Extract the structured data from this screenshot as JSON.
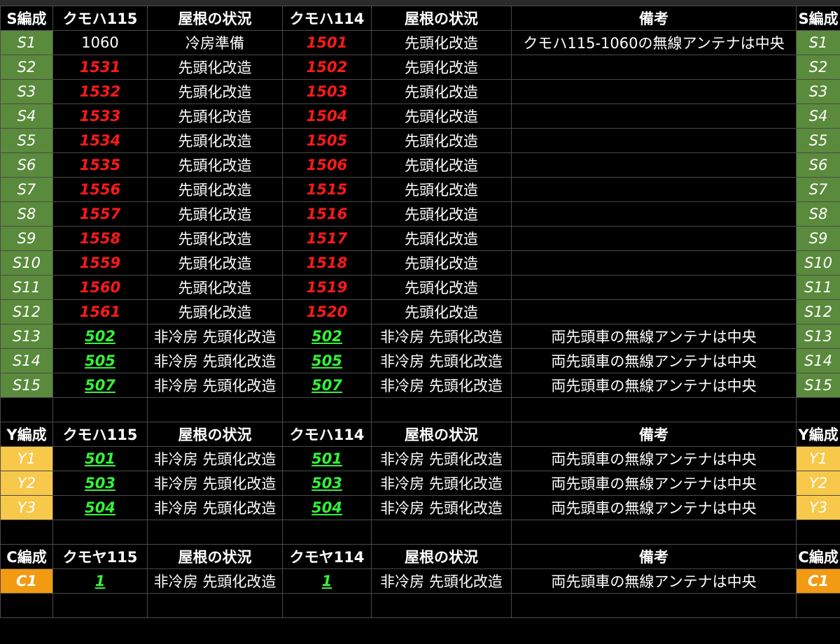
{
  "sections": [
    {
      "key": "S",
      "headers": [
        "S編成",
        "クモハ115",
        "屋根の状況",
        "クモハ114",
        "屋根の状況",
        "備考",
        "S編成"
      ],
      "rows": [
        {
          "id": "S1",
          "a": "1060",
          "a_style": "plain",
          "roof_a": "冷房準備",
          "b": "1501",
          "b_style": "red",
          "roof_b": "先頭化改造",
          "note": "クモハ115-1060の無線アンテナは中央"
        },
        {
          "id": "S2",
          "a": "1531",
          "a_style": "red",
          "roof_a": "先頭化改造",
          "b": "1502",
          "b_style": "red",
          "roof_b": "先頭化改造",
          "note": ""
        },
        {
          "id": "S3",
          "a": "1532",
          "a_style": "red",
          "roof_a": "先頭化改造",
          "b": "1503",
          "b_style": "red",
          "roof_b": "先頭化改造",
          "note": ""
        },
        {
          "id": "S4",
          "a": "1533",
          "a_style": "red",
          "roof_a": "先頭化改造",
          "b": "1504",
          "b_style": "red",
          "roof_b": "先頭化改造",
          "note": ""
        },
        {
          "id": "S5",
          "a": "1534",
          "a_style": "red",
          "roof_a": "先頭化改造",
          "b": "1505",
          "b_style": "red",
          "roof_b": "先頭化改造",
          "note": ""
        },
        {
          "id": "S6",
          "a": "1535",
          "a_style": "red",
          "roof_a": "先頭化改造",
          "b": "1506",
          "b_style": "red",
          "roof_b": "先頭化改造",
          "note": ""
        },
        {
          "id": "S7",
          "a": "1556",
          "a_style": "red",
          "roof_a": "先頭化改造",
          "b": "1515",
          "b_style": "red",
          "roof_b": "先頭化改造",
          "note": ""
        },
        {
          "id": "S8",
          "a": "1557",
          "a_style": "red",
          "roof_a": "先頭化改造",
          "b": "1516",
          "b_style": "red",
          "roof_b": "先頭化改造",
          "note": ""
        },
        {
          "id": "S9",
          "a": "1558",
          "a_style": "red",
          "roof_a": "先頭化改造",
          "b": "1517",
          "b_style": "red",
          "roof_b": "先頭化改造",
          "note": ""
        },
        {
          "id": "S10",
          "a": "1559",
          "a_style": "red",
          "roof_a": "先頭化改造",
          "b": "1518",
          "b_style": "red",
          "roof_b": "先頭化改造",
          "note": ""
        },
        {
          "id": "S11",
          "a": "1560",
          "a_style": "red",
          "roof_a": "先頭化改造",
          "b": "1519",
          "b_style": "red",
          "roof_b": "先頭化改造",
          "note": ""
        },
        {
          "id": "S12",
          "a": "1561",
          "a_style": "red",
          "roof_a": "先頭化改造",
          "b": "1520",
          "b_style": "red",
          "roof_b": "先頭化改造",
          "note": ""
        },
        {
          "id": "S13",
          "a": "502",
          "a_style": "green",
          "roof_a": "非冷房 先頭化改造",
          "b": "502",
          "b_style": "green",
          "roof_b": "非冷房 先頭化改造",
          "note": "両先頭車の無線アンテナは中央"
        },
        {
          "id": "S14",
          "a": "505",
          "a_style": "green",
          "roof_a": "非冷房 先頭化改造",
          "b": "505",
          "b_style": "green",
          "roof_b": "非冷房 先頭化改造",
          "note": "両先頭車の無線アンテナは中央"
        },
        {
          "id": "S15",
          "a": "507",
          "a_style": "green",
          "roof_a": "非冷房 先頭化改造",
          "b": "507",
          "b_style": "green",
          "roof_b": "非冷房 先頭化改造",
          "note": "両先頭車の無線アンテナは中央"
        }
      ]
    },
    {
      "key": "Y",
      "headers": [
        "Y編成",
        "クモハ115",
        "屋根の状況",
        "クモハ114",
        "屋根の状況",
        "備考",
        "Y編成"
      ],
      "rows": [
        {
          "id": "Y1",
          "a": "501",
          "a_style": "green",
          "roof_a": "非冷房 先頭化改造",
          "b": "501",
          "b_style": "green",
          "roof_b": "非冷房 先頭化改造",
          "note": "両先頭車の無線アンテナは中央"
        },
        {
          "id": "Y2",
          "a": "503",
          "a_style": "green",
          "roof_a": "非冷房 先頭化改造",
          "b": "503",
          "b_style": "green",
          "roof_b": "非冷房 先頭化改造",
          "note": "両先頭車の無線アンテナは中央"
        },
        {
          "id": "Y3",
          "a": "504",
          "a_style": "green",
          "roof_a": "非冷房 先頭化改造",
          "b": "504",
          "b_style": "green",
          "roof_b": "非冷房 先頭化改造",
          "note": "両先頭車の無線アンテナは中央"
        }
      ]
    },
    {
      "key": "C",
      "headers": [
        "C編成",
        "クモヤ115",
        "屋根の状況",
        "クモヤ114",
        "屋根の状況",
        "備考",
        "C編成"
      ],
      "rows": [
        {
          "id": "C1",
          "a": "1",
          "a_style": "green",
          "roof_a": "非冷房 先頭化改造",
          "b": "1",
          "b_style": "green",
          "roof_b": "非冷房 先頭化改造",
          "note": "両先頭車の無線アンテナは中央"
        }
      ]
    }
  ],
  "colors": {
    "s_fill": "#5a8a3c",
    "y_fill": "#f7c84a",
    "c_fill": "#f29a12",
    "red_number": "#ff1a1a",
    "green_number": "#34f23a",
    "background": "#000000",
    "grid": "#4a4a4a"
  }
}
